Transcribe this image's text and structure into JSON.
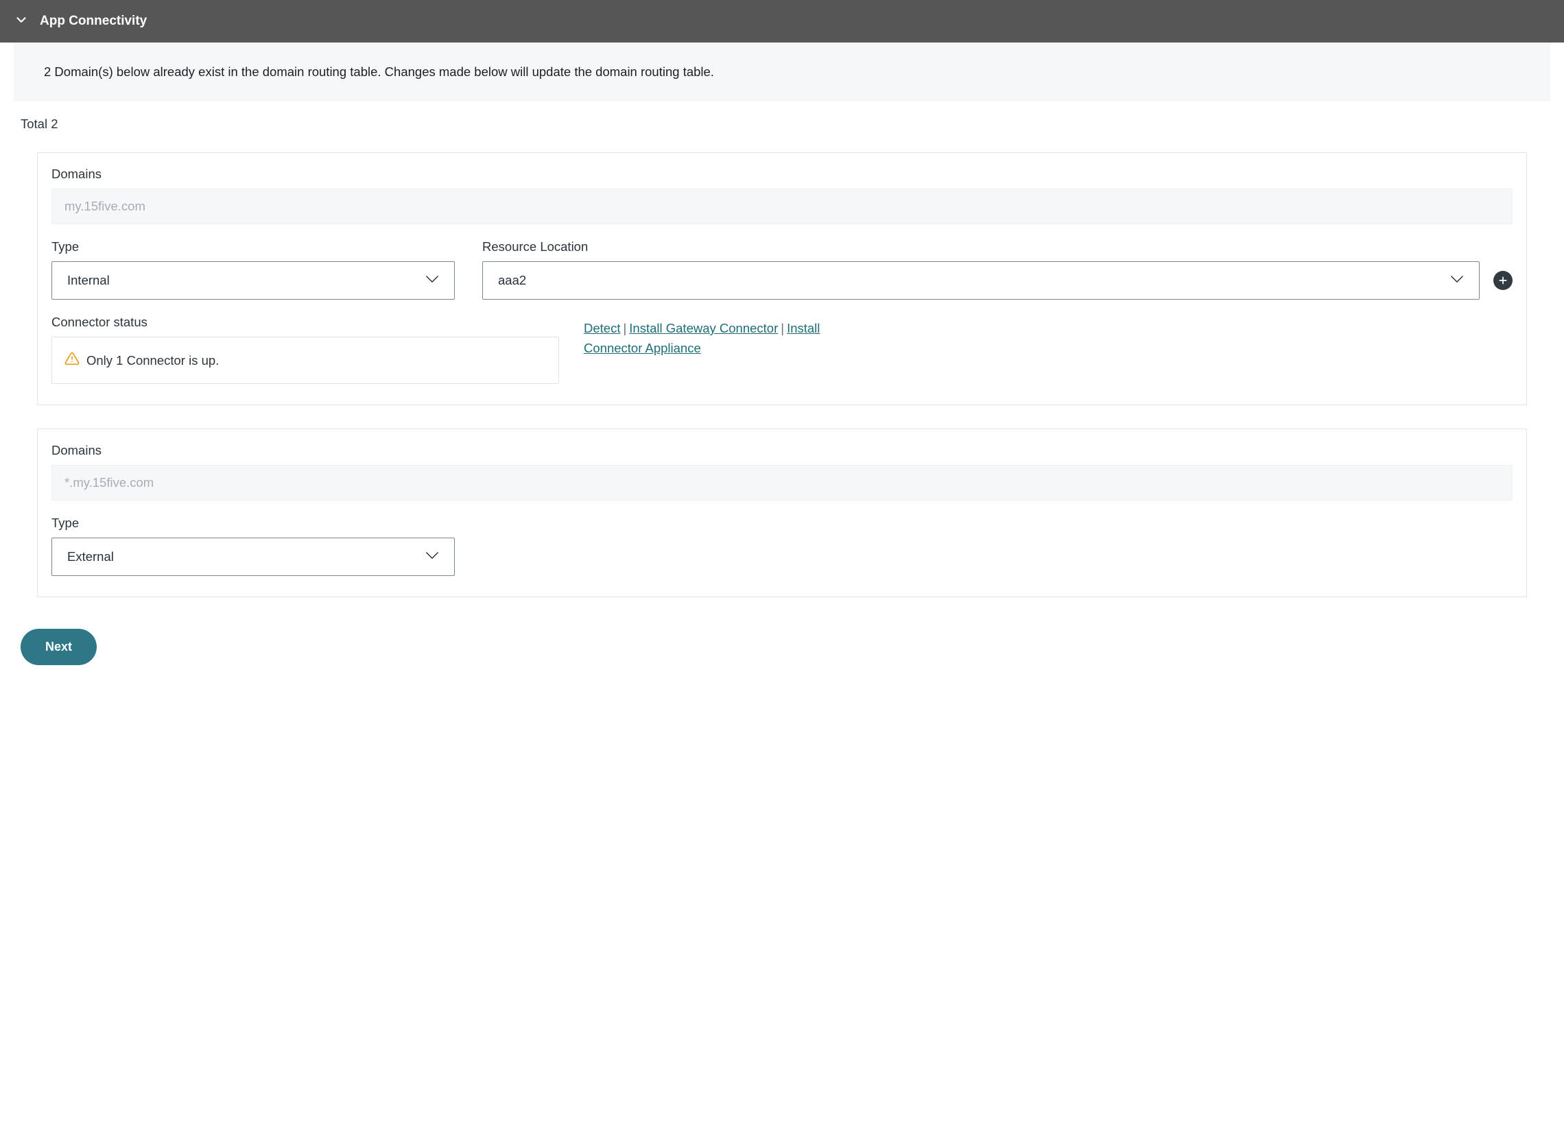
{
  "header": {
    "title": "App Connectivity"
  },
  "banner": {
    "text": "2 Domain(s) below already exist in the domain routing table. Changes made below will update the domain routing table."
  },
  "total": {
    "label": "Total 2"
  },
  "labels": {
    "domains": "Domains",
    "type": "Type",
    "resource_location": "Resource Location",
    "connector_status": "Connector status"
  },
  "cards": [
    {
      "domain": "my.15five.com",
      "type": "Internal",
      "resource_location": "aaa2",
      "connector_status_msg": "Only 1 Connector is up."
    },
    {
      "domain": "*.my.15five.com",
      "type": "External"
    }
  ],
  "links": {
    "detect": "Detect",
    "install_gateway": "Install Gateway Connector",
    "install_appliance": "Install Connector Appliance"
  },
  "footer": {
    "next": "Next"
  }
}
